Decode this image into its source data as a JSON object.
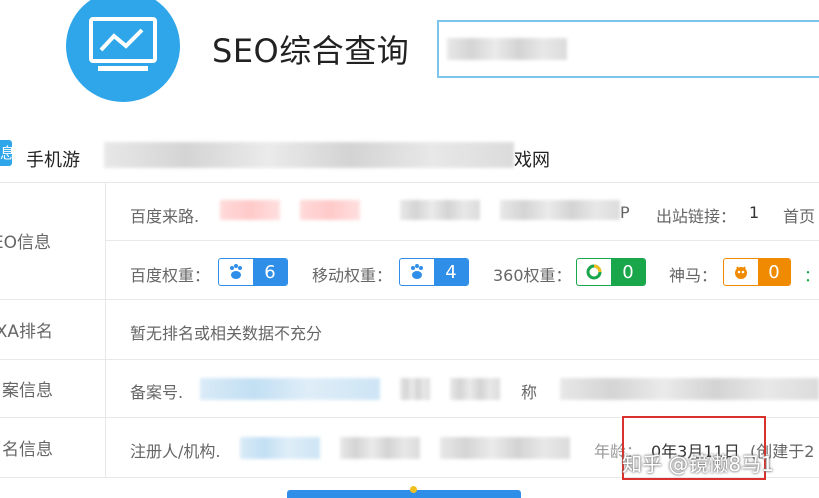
{
  "header": {
    "title": "SEO综合查询"
  },
  "site": {
    "tag": "息",
    "title_start": "手机游",
    "title_end": "戏网"
  },
  "rows": {
    "seo": {
      "label": "EO信息",
      "baidu_source_label": "百度来路.",
      "baidu_source_tail": "P",
      "outbound_label": "出站链接：",
      "outbound_value": "1",
      "homepage_label": "首页",
      "baidu_weight_label": "百度权重：",
      "baidu_weight": "6",
      "mobile_weight_label": "移动权重：",
      "mobile_weight": "4",
      "weight360_label": "360权重：",
      "weight360": "0",
      "shenma_label": "神马：",
      "shenma": "0"
    },
    "alexa": {
      "label": "EXA排名",
      "text": "暂无排名或相关数据不充分"
    },
    "icp": {
      "label": "案信息",
      "number_label": "备案号.",
      "name_label": "称"
    },
    "whois": {
      "label": "名信息",
      "registrant_label": "注册人/机构.",
      "age_label": "年龄：",
      "age_value": "0年3月11日",
      "created_label": "(创建于2"
    }
  },
  "watermark": {
    "text": "知乎 @镜懒8马1"
  },
  "colors": {
    "accent": "#2fa6ea",
    "baidu_badge": "#2f8fe8",
    "badge_360": "#1aa64a",
    "shenma_badge": "#f08a00",
    "highlight": "#d9312c"
  },
  "icons": {
    "logo": "monitor-chart-icon",
    "baidu": "paw-icon",
    "s360": "ring-icon",
    "shenma": "horse-icon"
  }
}
